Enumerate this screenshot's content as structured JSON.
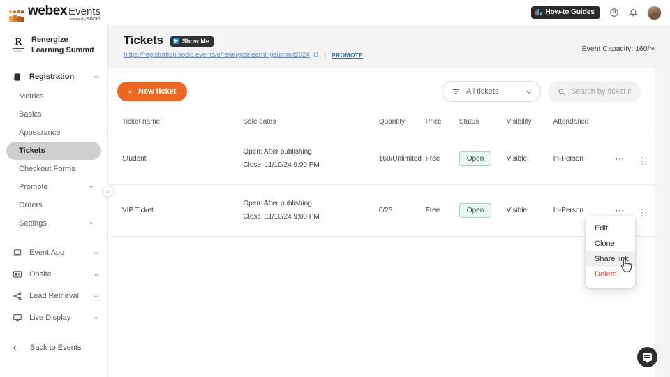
{
  "brand": {
    "logo_name": "webex",
    "logo_product": "Events",
    "logo_formerly_prefix": "formerly",
    "logo_formerly_brand": "SOCIO",
    "accent_orange": "#ec6820",
    "link_blue": "#5a8fd8",
    "danger_red": "#e0443c",
    "status_green_border": "#9fd6cb",
    "status_green_bg": "#eaf7f4"
  },
  "topbar": {
    "guides_label": "How-to Guides",
    "help_icon": "help-circle-icon",
    "bell_icon": "bell-icon",
    "avatar_icon": "user-avatar"
  },
  "sidebar": {
    "event_name": "Renergize Learning Summit",
    "event_logo_letter": "R",
    "event_logo_sub": "renergize",
    "group": {
      "label": "Registration",
      "icon": "registration-icon",
      "chevron": "chevron-up-icon"
    },
    "sub_items": [
      {
        "label": "Metrics",
        "active": false
      },
      {
        "label": "Basics",
        "active": false
      },
      {
        "label": "Appearance",
        "active": false
      },
      {
        "label": "Tickets",
        "active": true
      },
      {
        "label": "Checkout Forms",
        "active": false
      },
      {
        "label": "Promote",
        "active": false,
        "chevron": "chevron-down-icon"
      },
      {
        "label": "Orders",
        "active": false
      },
      {
        "label": "Settings",
        "active": false,
        "chevron": "chevron-down-icon"
      }
    ],
    "sections": [
      {
        "label": "Event App",
        "icon": "laptop-icon",
        "chevron": "chevron-down-icon"
      },
      {
        "label": "Onsite",
        "icon": "badge-icon",
        "chevron": "chevron-down-icon"
      },
      {
        "label": "Lead Retrieval",
        "icon": "share-nodes-icon",
        "chevron": "chevron-down-icon"
      },
      {
        "label": "Live Display",
        "icon": "monitor-icon",
        "chevron": "chevron-down-icon"
      }
    ],
    "back_label": "Back to Events",
    "back_icon": "arrow-left-icon",
    "collapse_icon": "chevron-left-icon"
  },
  "page": {
    "title": "Tickets",
    "show_me_label": "Show Me",
    "url": "https://registration.socio.events/e/renergizelearningsummit2024",
    "external_icon": "external-link-icon",
    "separator": "|",
    "promote_label": "PROMOTE",
    "capacity_label": "Event Capacity: 160/∞"
  },
  "toolbar": {
    "new_ticket_label": "New ticket",
    "new_ticket_icon": "chevron-down-icon",
    "filter_label": "All tickets",
    "filter_icon": "filter-lines-icon",
    "filter_chevron": "chevron-down-icon",
    "search_placeholder": "Search by ticket name",
    "search_value": "",
    "search_icon": "search-icon"
  },
  "table": {
    "columns": [
      "Ticket name",
      "Sale dates",
      "Quantity",
      "Price",
      "Status",
      "Visibility",
      "Attendance"
    ],
    "rows": [
      {
        "name": "Student",
        "open_date": "Open: After publishing",
        "close_date": "Close: 11/10/24 9:00 PM",
        "quantity": "160/Unlimited",
        "price": "Free",
        "status": "Open",
        "visibility": "Visible",
        "attendance": "In-Person",
        "menu_icon": "ellipsis-icon",
        "drag_icon": "drag-handle-icon"
      },
      {
        "name": "VIP Ticket",
        "open_date": "Open: After publishing",
        "close_date": "Close: 11/10/24 9:00 PM",
        "quantity": "0/25",
        "price": "Free",
        "status": "Open",
        "visibility": "Visible",
        "attendance": "In-Person",
        "menu_icon": "ellipsis-icon",
        "drag_icon": "drag-handle-icon"
      }
    ]
  },
  "context_menu": {
    "items": [
      {
        "label": "Edit",
        "hovered": false,
        "danger": false
      },
      {
        "label": "Clone",
        "hovered": false,
        "danger": false
      },
      {
        "label": "Share link",
        "hovered": true,
        "danger": false
      },
      {
        "label": "Delete",
        "hovered": false,
        "danger": true
      }
    ]
  },
  "chat": {
    "icon": "chat-bubble-icon"
  }
}
